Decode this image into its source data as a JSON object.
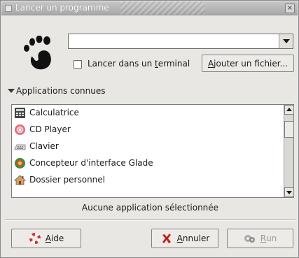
{
  "window": {
    "title": "Lancer un programme",
    "close_glyph": "×"
  },
  "command": {
    "value": "",
    "placeholder": ""
  },
  "terminal_option": {
    "label_prefix": "Lancer dans un ",
    "label_accel": "t",
    "label_suffix": "erminal",
    "checked": false
  },
  "add_file_button": {
    "label_accel": "A",
    "label_rest": "jouter un fichier..."
  },
  "expander": {
    "label": "Applications connues",
    "expanded": true
  },
  "apps": [
    {
      "label": "Calculatrice",
      "icon": "calculator-icon"
    },
    {
      "label": "CD Player",
      "icon": "cd-player-icon"
    },
    {
      "label": "Clavier",
      "icon": "keyboard-icon"
    },
    {
      "label": "Concepteur d'interface Glade",
      "icon": "glade-icon"
    },
    {
      "label": "Dossier personnel",
      "icon": "home-folder-icon"
    }
  ],
  "status_text": "Aucune application sélectionnée",
  "buttons": {
    "help": {
      "accel": "A",
      "rest": "ide",
      "icon": "lifebuoy-icon"
    },
    "cancel": {
      "accel": "A",
      "rest": "nnuler",
      "icon": "cancel-x-icon"
    },
    "run": {
      "accel": "R",
      "rest": "un",
      "icon": "run-icon",
      "enabled": false
    }
  },
  "colors": {
    "window_bg": "#e8e7e4",
    "titlebar": "#b5b5b5",
    "disabled_text": "#9a9a9a",
    "cancel_x": "#c0211a"
  }
}
